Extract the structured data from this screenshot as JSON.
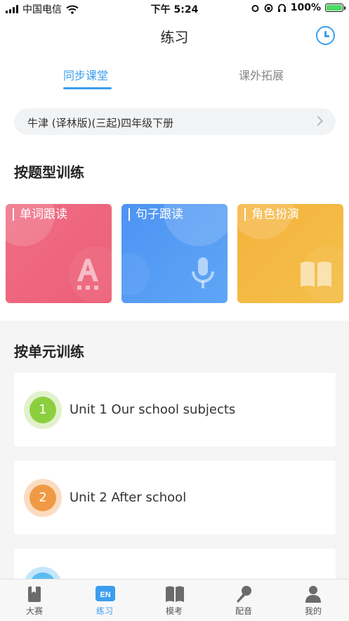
{
  "status_bar": {
    "carrier": "中国电信",
    "time": "下午 5:24",
    "battery": "100%"
  },
  "nav": {
    "title": "练习"
  },
  "tabs": [
    {
      "label": "同步课堂"
    },
    {
      "label": "课外拓展"
    }
  ],
  "book": {
    "name": "牛津 (译林版)(三起)四年级下册"
  },
  "question_section": {
    "title": "按题型训练",
    "cards": [
      {
        "label": "单词跟读",
        "icon": "letter-a-icon",
        "color": "#ec5f78"
      },
      {
        "label": "句子跟读",
        "icon": "microphone-icon",
        "color": "#4d93f3"
      },
      {
        "label": "角色扮演",
        "icon": "book-icon",
        "color": "#f5b33e"
      }
    ]
  },
  "unit_section": {
    "title": "按单元训练",
    "units": [
      {
        "number": "1",
        "name": "Unit 1 Our school subjects",
        "color": "#8ccf3e"
      },
      {
        "number": "2",
        "name": "Unit 2 After school",
        "color": "#f09a45"
      }
    ]
  },
  "tabbar": [
    {
      "label": "大赛",
      "icon": "bookmark-book-icon"
    },
    {
      "label": "练习",
      "icon": "en-icon",
      "badge": "EN"
    },
    {
      "label": "模考",
      "icon": "open-book-icon"
    },
    {
      "label": "配音",
      "icon": "microphone-icon"
    },
    {
      "label": "我的",
      "icon": "person-icon"
    }
  ]
}
